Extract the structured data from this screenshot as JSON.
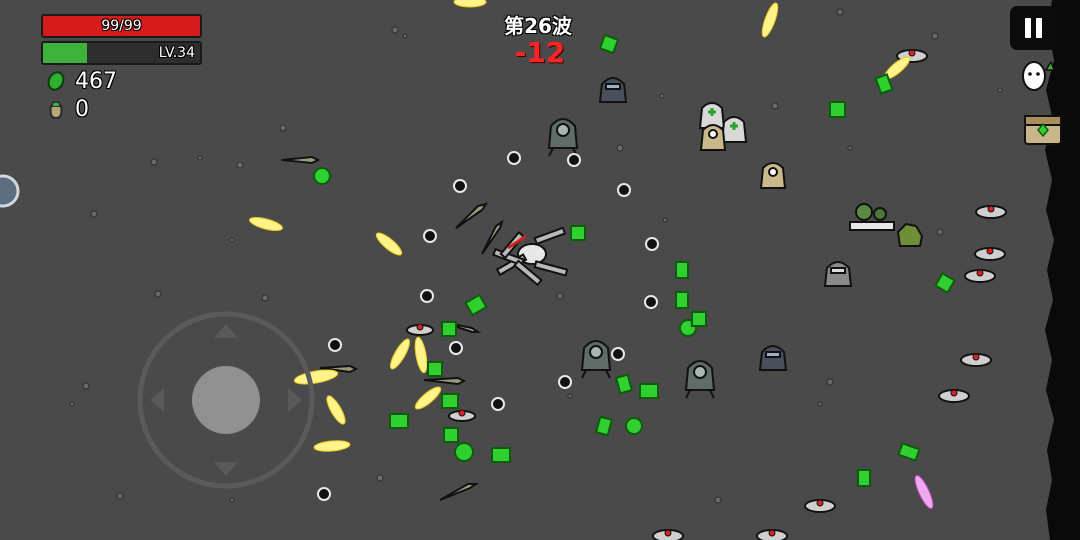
{
  "hud": {
    "hp": {
      "text": "99/99",
      "fill": 1.0
    },
    "xp": {
      "text": "LV.34",
      "fill": 0.28
    },
    "materials": {
      "value": "467",
      "icon": "green-material-icon"
    },
    "bag": {
      "value": "0",
      "icon": "money-bag-icon"
    },
    "wave": "第26波",
    "damage_popup": "-12"
  },
  "controls": {
    "pause": "pause-icon",
    "egg": "egg-item-icon",
    "chest": "treasure-chest-icon",
    "joystick": "virtual-joystick"
  },
  "colors": {
    "background": "#4a4a4a",
    "hp": "#d51b1b",
    "xp": "#3db33d",
    "material": "#2fd02f",
    "bullet": "#fff38a",
    "damage": "#ff2424"
  }
}
